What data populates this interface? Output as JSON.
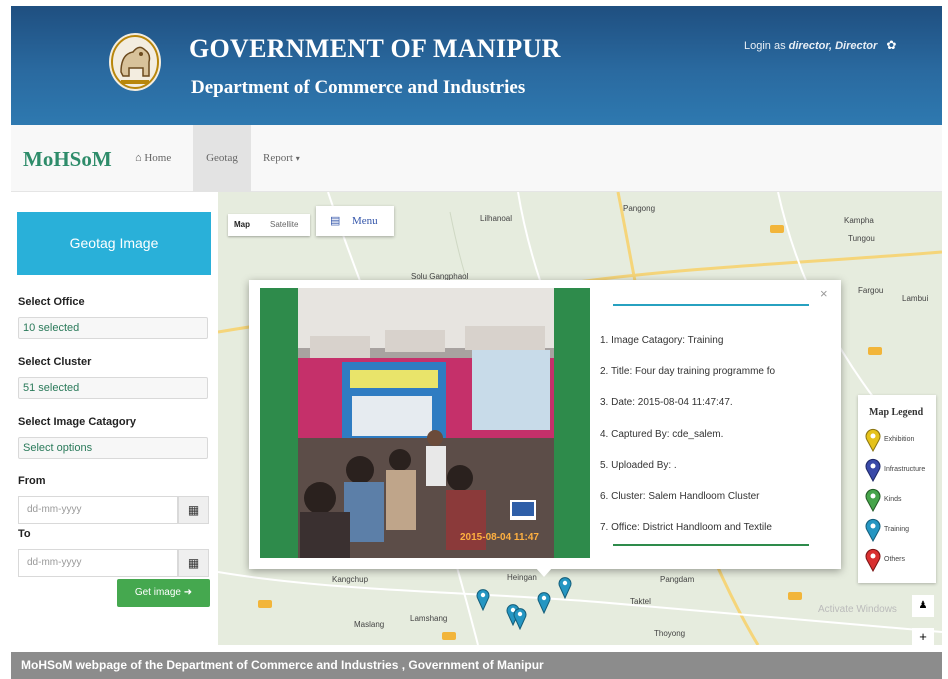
{
  "header": {
    "title": "GOVERNMENT OF MANIPUR",
    "subtitle": "Department of Commerce and Industries",
    "login_prefix": "Login as",
    "login_user": "director, Director"
  },
  "navbar": {
    "brand": "MoHSoM",
    "home": "Home",
    "geotag": "Geotag",
    "report": "Report"
  },
  "sidebar": {
    "geotag_button": "Geotag Image",
    "office_label": "Select Office",
    "office_value": "10 selected",
    "cluster_label": "Select Cluster",
    "cluster_value": "51 selected",
    "category_label": "Select Image Catagory",
    "category_value": "Select options",
    "from_label": "From",
    "from_placeholder": "dd-mm-yyyy",
    "to_label": "To",
    "to_placeholder": "dd-mm-yyyy",
    "get_button": "Get image"
  },
  "map": {
    "map_label": "Map",
    "satellite_label": "Satellite",
    "menu_label": "Menu",
    "places": [
      "Lilhanoal",
      "Pangong",
      "Kampha",
      "Tungou",
      "Solu Gangphaol",
      "Fargou",
      "Lambui",
      "Kangchup",
      "Heingan",
      "Pangdam",
      "Taktel",
      "Lamshang",
      "Maslang",
      "Thoyong"
    ],
    "watermark": "Activate Windows"
  },
  "legend": {
    "title": "Map Legend",
    "items": [
      {
        "label": "Exhibition",
        "color": "#e5c21a"
      },
      {
        "label": "Infrastructure",
        "color": "#3949a8"
      },
      {
        "label": "Kinds",
        "color": "#46a44a"
      },
      {
        "label": "Training",
        "color": "#2596c2"
      },
      {
        "label": "Others",
        "color": "#d93030"
      }
    ]
  },
  "popup": {
    "line1": "1. Image Catagory: Training",
    "line2": "2. Title: Four day training programme fo",
    "line3": "3. Date: 2015-08-04 11:47:47.",
    "line4": "4. Captured By: cde_salem.",
    "line5": "5. Uploaded By: .",
    "line6": "6. Cluster: Salem Handloom Cluster",
    "line7": "7. Office: District Handloom and Textile",
    "photo_timestamp": "2015-08-04 11:47"
  },
  "caption": "MoHSoM webpage of the Department of Commerce and Industries , Government of Manipur"
}
